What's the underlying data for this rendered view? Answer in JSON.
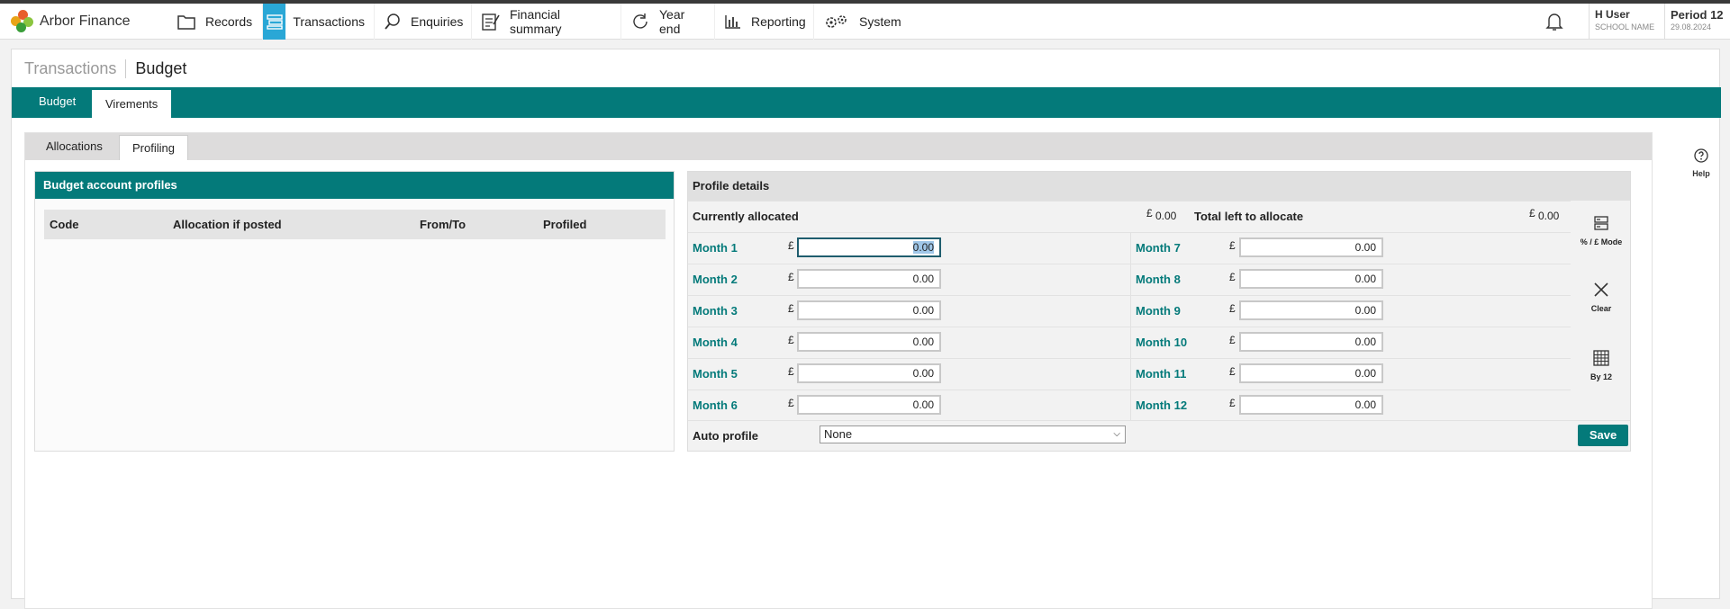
{
  "app": {
    "name": "Arbor Finance"
  },
  "nav": [
    {
      "label": "Records",
      "icon": "folder-icon"
    },
    {
      "label": "Transactions",
      "icon": "transactions-icon",
      "active": true
    },
    {
      "label": "Enquiries",
      "icon": "search-icon"
    },
    {
      "label": "Financial summary",
      "icon": "clipboard-icon"
    },
    {
      "label": "Year end",
      "icon": "refresh-icon"
    },
    {
      "label": "Reporting",
      "icon": "bar-chart-icon"
    },
    {
      "label": "System",
      "icon": "gears-icon"
    }
  ],
  "user": {
    "name": "H User",
    "school": "SCHOOL NAME"
  },
  "period": {
    "label": "Period 12",
    "date": "29.08.2024"
  },
  "breadcrumb": {
    "parent": "Transactions",
    "current": "Budget"
  },
  "tabs": {
    "budget": "Budget",
    "virements": "Virements"
  },
  "subtabs": {
    "allocations": "Allocations",
    "profiling": "Profiling"
  },
  "help": {
    "label": "Help"
  },
  "budget_account_profiles": {
    "title": "Budget account profiles",
    "columns": [
      "Code",
      "Allocation if posted",
      "From/To",
      "Profiled"
    ]
  },
  "profile_details": {
    "title": "Profile details",
    "currently_allocated_label": "Currently allocated",
    "currently_allocated_value": "0.00",
    "total_left_label": "Total left to allocate",
    "total_left_value": "0.00",
    "currency": "£",
    "months_left": [
      {
        "label": "Month 1",
        "value": "0.00"
      },
      {
        "label": "Month 2",
        "value": "0.00"
      },
      {
        "label": "Month 3",
        "value": "0.00"
      },
      {
        "label": "Month 4",
        "value": "0.00"
      },
      {
        "label": "Month 5",
        "value": "0.00"
      },
      {
        "label": "Month 6",
        "value": "0.00"
      }
    ],
    "months_right": [
      {
        "label": "Month 7",
        "value": "0.00"
      },
      {
        "label": "Month 8",
        "value": "0.00"
      },
      {
        "label": "Month 9",
        "value": "0.00"
      },
      {
        "label": "Month 10",
        "value": "0.00"
      },
      {
        "label": "Month 11",
        "value": "0.00"
      },
      {
        "label": "Month 12",
        "value": "0.00"
      }
    ],
    "side_buttons": {
      "mode": "% / £ Mode",
      "clear": "Clear",
      "by12": "By 12"
    },
    "auto_profile_label": "Auto profile",
    "auto_profile_value": "None",
    "save_label": "Save"
  },
  "colors": {
    "teal": "#047a7a",
    "active_nav": "#2aa7d6"
  }
}
